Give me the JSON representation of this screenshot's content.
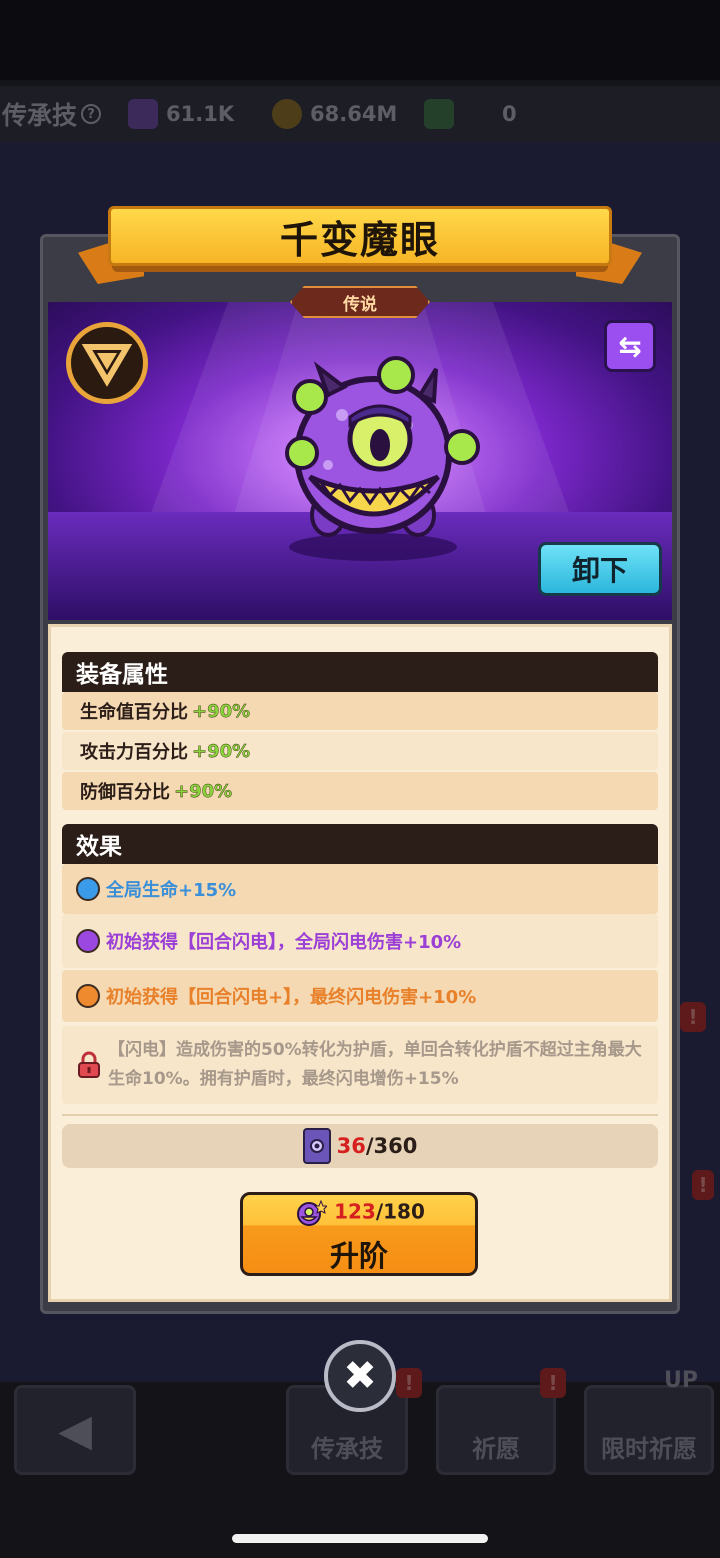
{
  "background": {
    "header_title": "传承技",
    "help_icon": "?",
    "resources": [
      {
        "icon": "purple-cube-plus-icon",
        "value": "61.1K"
      },
      {
        "icon": "gold-coin-plus-icon",
        "value": "68.64M"
      },
      {
        "icon": "green-gem-plus-icon",
        "value": "0"
      }
    ],
    "nav": {
      "back_icon": "arrow-left-icon",
      "legacy_skill": "传承技",
      "wish": "祈愿",
      "limited_wish": "限时祈愿",
      "up_badge": "UP",
      "alert_badge": "!"
    }
  },
  "modal": {
    "title": "千变魔眼",
    "rarity": "传说",
    "class_icon": "triangle-emblem-icon",
    "swap_icon": "swap-arrows-icon",
    "unequip_label": "卸下",
    "attributes": {
      "header": "装备属性",
      "rows": [
        {
          "label": "生命值百分比",
          "value": "+90%"
        },
        {
          "label": "攻击力百分比",
          "value": "+90%"
        },
        {
          "label": "防御百分比",
          "value": "+90%"
        }
      ]
    },
    "effects": {
      "header": "效果",
      "rows": [
        {
          "text": "全局生命+15%",
          "color": "#3a8fd9",
          "dot_color": "#3c9be8"
        },
        {
          "text": "初始获得【回合闪电】，全局闪电伤害+10%",
          "color": "#9b3fd6",
          "dot_color": "#9b48e0"
        },
        {
          "text": "初始获得【回合闪电+】，最终闪电伤害+10%",
          "color": "#e8812a",
          "dot_color": "#f08a2e"
        }
      ],
      "locked": {
        "icon": "lock-icon",
        "text": "【闪电】造成伤害的50%转化为护盾，单回合转化护盾不超过主角最大生命10%。拥有护盾时，最终闪电增伤+15%"
      }
    },
    "shards": {
      "icon": "purple-book-icon",
      "current": "36",
      "total": "/360"
    },
    "upgrade": {
      "icon": "creature-token-icon",
      "current": "123",
      "total": "/180",
      "label": "升阶"
    },
    "close_icon": "close-x-icon"
  }
}
